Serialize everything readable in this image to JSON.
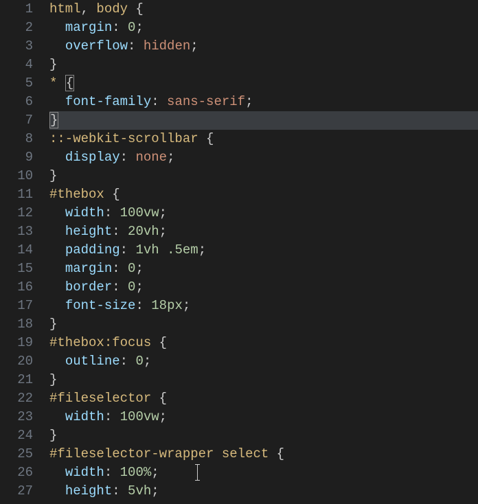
{
  "gutterStart": 1,
  "gutterEnd": 27,
  "currentLine": 7,
  "cursorAtLine": 26,
  "lines": [
    [
      [
        "sel",
        "html"
      ],
      [
        "punc",
        ", "
      ],
      [
        "sel",
        "body"
      ],
      [
        "punc",
        " {"
      ]
    ],
    [
      [
        "guide",
        "  "
      ],
      [
        "prop",
        "margin"
      ],
      [
        "punc",
        ": "
      ],
      [
        "num",
        "0"
      ],
      [
        "punc",
        ";"
      ]
    ],
    [
      [
        "guide",
        "  "
      ],
      [
        "prop",
        "overflow"
      ],
      [
        "punc",
        ": "
      ],
      [
        "val",
        "hidden"
      ],
      [
        "punc",
        ";"
      ]
    ],
    [
      [
        "punc",
        "}"
      ]
    ],
    [
      [
        "sel",
        "*"
      ],
      [
        "punc",
        " "
      ],
      [
        "box",
        "{"
      ]
    ],
    [
      [
        "guide",
        "  "
      ],
      [
        "prop",
        "font-family"
      ],
      [
        "punc",
        ": "
      ],
      [
        "val",
        "sans-serif"
      ],
      [
        "punc",
        ";"
      ]
    ],
    [
      [
        "box",
        "}"
      ]
    ],
    [
      [
        "sel",
        "::-webkit-scrollbar"
      ],
      [
        "punc",
        " {"
      ]
    ],
    [
      [
        "guide",
        "  "
      ],
      [
        "prop",
        "display"
      ],
      [
        "punc",
        ": "
      ],
      [
        "val",
        "none"
      ],
      [
        "punc",
        ";"
      ]
    ],
    [
      [
        "punc",
        "}"
      ]
    ],
    [
      [
        "sel",
        "#thebox"
      ],
      [
        "punc",
        " {"
      ]
    ],
    [
      [
        "guide",
        "  "
      ],
      [
        "prop",
        "width"
      ],
      [
        "punc",
        ": "
      ],
      [
        "num",
        "100"
      ],
      [
        "num",
        "vw"
      ],
      [
        "punc",
        ";"
      ]
    ],
    [
      [
        "guide",
        "  "
      ],
      [
        "prop",
        "height"
      ],
      [
        "punc",
        ": "
      ],
      [
        "num",
        "20"
      ],
      [
        "num",
        "vh"
      ],
      [
        "punc",
        ";"
      ]
    ],
    [
      [
        "guide",
        "  "
      ],
      [
        "prop",
        "padding"
      ],
      [
        "punc",
        ": "
      ],
      [
        "num",
        "1"
      ],
      [
        "num",
        "vh"
      ],
      [
        "punc",
        " "
      ],
      [
        "num",
        ".5"
      ],
      [
        "num",
        "em"
      ],
      [
        "punc",
        ";"
      ]
    ],
    [
      [
        "guide",
        "  "
      ],
      [
        "prop",
        "margin"
      ],
      [
        "punc",
        ": "
      ],
      [
        "num",
        "0"
      ],
      [
        "punc",
        ";"
      ]
    ],
    [
      [
        "guide",
        "  "
      ],
      [
        "prop",
        "border"
      ],
      [
        "punc",
        ": "
      ],
      [
        "num",
        "0"
      ],
      [
        "punc",
        ";"
      ]
    ],
    [
      [
        "guide",
        "  "
      ],
      [
        "prop",
        "font-size"
      ],
      [
        "punc",
        ": "
      ],
      [
        "num",
        "18"
      ],
      [
        "num",
        "px"
      ],
      [
        "punc",
        ";"
      ]
    ],
    [
      [
        "punc",
        "}"
      ]
    ],
    [
      [
        "sel",
        "#thebox"
      ],
      [
        "pseudo",
        ":focus"
      ],
      [
        "punc",
        " {"
      ]
    ],
    [
      [
        "guide",
        "  "
      ],
      [
        "prop",
        "outline"
      ],
      [
        "punc",
        ": "
      ],
      [
        "num",
        "0"
      ],
      [
        "punc",
        ";"
      ]
    ],
    [
      [
        "punc",
        "}"
      ]
    ],
    [
      [
        "sel",
        "#fileselector"
      ],
      [
        "punc",
        " {"
      ]
    ],
    [
      [
        "guide",
        "  "
      ],
      [
        "prop",
        "width"
      ],
      [
        "punc",
        ": "
      ],
      [
        "num",
        "100"
      ],
      [
        "num",
        "vw"
      ],
      [
        "punc",
        ";"
      ]
    ],
    [
      [
        "punc",
        "}"
      ]
    ],
    [
      [
        "sel",
        "#fileselector-wrapper"
      ],
      [
        "punc",
        " "
      ],
      [
        "sel",
        "select"
      ],
      [
        "punc",
        " {"
      ]
    ],
    [
      [
        "guide",
        "  "
      ],
      [
        "prop",
        "width"
      ],
      [
        "punc",
        ": "
      ],
      [
        "num",
        "100"
      ],
      [
        "num",
        "%"
      ],
      [
        "punc",
        ";"
      ]
    ],
    [
      [
        "guide",
        "  "
      ],
      [
        "prop",
        "height"
      ],
      [
        "punc",
        ": "
      ],
      [
        "num",
        "5"
      ],
      [
        "num",
        "vh"
      ],
      [
        "punc",
        ";"
      ]
    ]
  ]
}
